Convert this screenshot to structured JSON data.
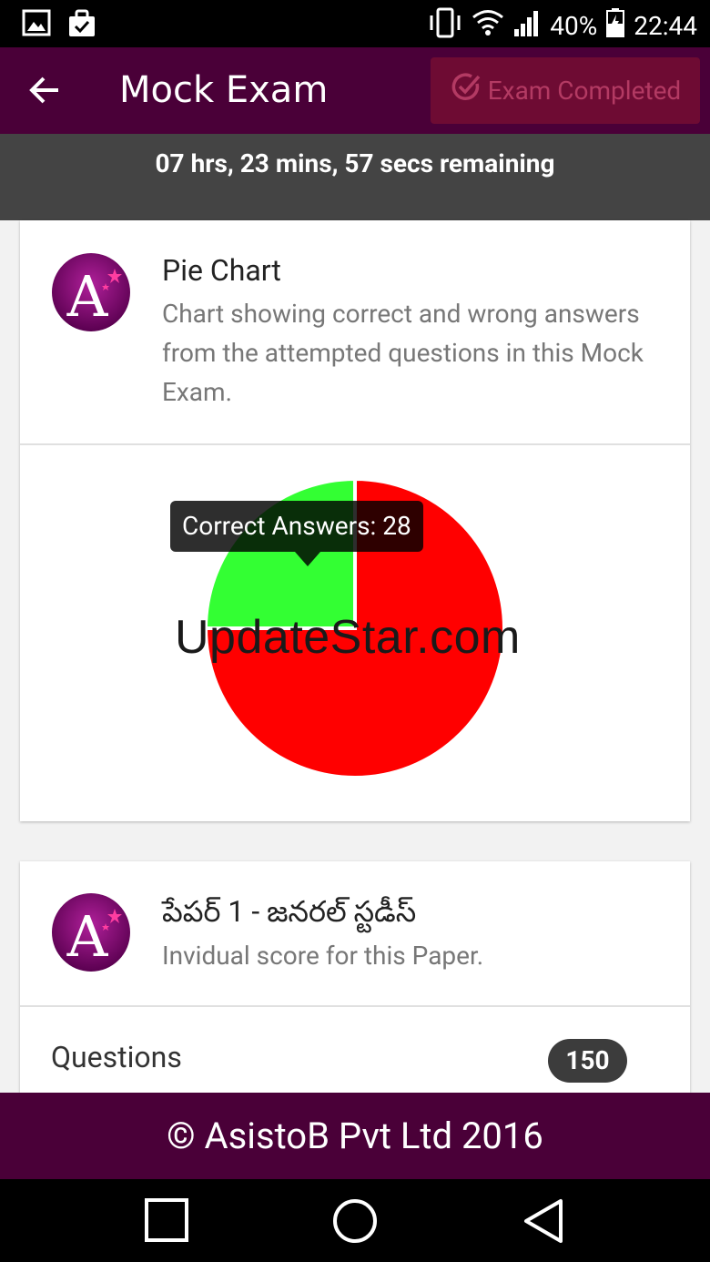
{
  "status_bar": {
    "battery": "40%",
    "time": "22:44",
    "icons": [
      "image-icon",
      "task-icon",
      "vibrate-icon",
      "wifi-icon",
      "signal-icon",
      "battery-icon"
    ]
  },
  "app_bar": {
    "title": "Mock Exam",
    "completed_label": "Exam Completed",
    "colors": {
      "bar": "#4a0038",
      "completed_bg": "#6e0b33",
      "completed_text": "#b33a63"
    }
  },
  "timer": {
    "text": "07 hrs, 23 mins, 57 secs remaining"
  },
  "pie_card": {
    "title": "Pie Chart",
    "subtitle": "Chart showing correct and wrong answers from the attempted questions in this Mock Exam.",
    "tooltip": "Correct Answers: 28",
    "watermark": "UpdateStar.com"
  },
  "chart_data": {
    "type": "pie",
    "slices": [
      {
        "label": "Correct Answers",
        "value": 28,
        "color": "#33ff33"
      },
      {
        "label": "Wrong Answers",
        "value": 84,
        "color": "#ff0000"
      }
    ]
  },
  "paper_card": {
    "title": "పేపర్ 1 - జనరల్ స్టడీస్",
    "subtitle": "Invidual score for this Paper.",
    "questions_label": "Questions",
    "questions_count": "150"
  },
  "footer": {
    "text": "© AsistoB Pvt Ltd 2016"
  },
  "nav": {
    "icons": [
      "recents-icon",
      "home-icon",
      "back-icon"
    ]
  }
}
